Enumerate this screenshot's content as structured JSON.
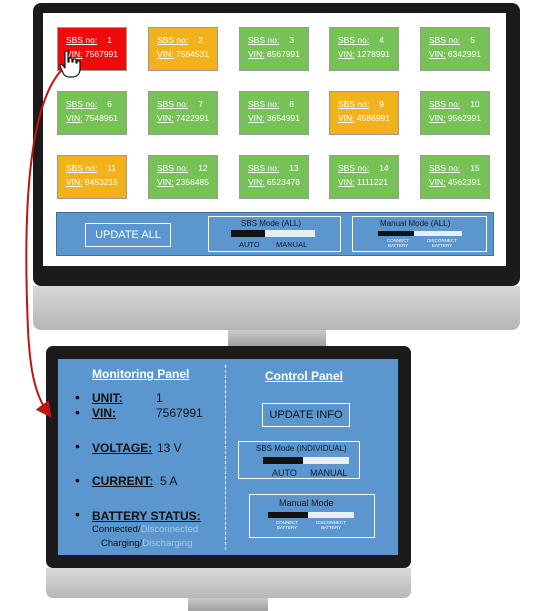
{
  "tiles": [
    {
      "sbs_label": "SBS no:",
      "sbs_no": "1",
      "vin_label": "VIN:",
      "vin": "7567991",
      "status": "red"
    },
    {
      "sbs_label": "SBS no:",
      "sbs_no": "2",
      "vin_label": "VIN:",
      "vin": "7564531",
      "status": "orange"
    },
    {
      "sbs_label": "SBS no:",
      "sbs_no": "3",
      "vin_label": "VIN:",
      "vin": "8567991",
      "status": "green"
    },
    {
      "sbs_label": "SBS no:",
      "sbs_no": "4",
      "vin_label": "VIN:",
      "vin": "1278991",
      "status": "green"
    },
    {
      "sbs_label": "SBS no:",
      "sbs_no": "5",
      "vin_label": "VIN:",
      "vin": "6342991",
      "status": "green"
    },
    {
      "sbs_label": "SBS no:",
      "sbs_no": "6",
      "vin_label": "VIN:",
      "vin": "7548961",
      "status": "green"
    },
    {
      "sbs_label": "SBS no:",
      "sbs_no": "7",
      "vin_label": "VIN:",
      "vin": "7422991",
      "status": "green"
    },
    {
      "sbs_label": "SBS no:",
      "sbs_no": "8",
      "vin_label": "VIN:",
      "vin": "3654991",
      "status": "green"
    },
    {
      "sbs_label": "SBS no:",
      "sbs_no": "9",
      "vin_label": "VIN:",
      "vin": "4586991",
      "status": "orange"
    },
    {
      "sbs_label": "SBS no:",
      "sbs_no": "10",
      "vin_label": "VIN:",
      "vin": "9562991",
      "status": "green"
    },
    {
      "sbs_label": "SBS no:",
      "sbs_no": "11",
      "vin_label": "VIN:",
      "vin": "9453215",
      "status": "orange"
    },
    {
      "sbs_label": "SBS no:",
      "sbs_no": "12",
      "vin_label": "VIN:",
      "vin": "2356485",
      "status": "green"
    },
    {
      "sbs_label": "SBS no:",
      "sbs_no": "13",
      "vin_label": "VIN:",
      "vin": "6523478",
      "status": "green"
    },
    {
      "sbs_label": "SBS no:",
      "sbs_no": "14",
      "vin_label": "VIN:",
      "vin": "1111221",
      "status": "green"
    },
    {
      "sbs_label": "SBS no:",
      "sbs_no": "15",
      "vin_label": "VIN:",
      "vin": "4562391",
      "status": "green"
    }
  ],
  "colors": {
    "green": "#77c257",
    "orange": "#f2b21c",
    "red": "#ee0b0b",
    "panel": "#5b96cf",
    "arrow": "#c0150f"
  },
  "top_controls": {
    "update_all": "UPDATE ALL",
    "sbs_mode_title": "SBS Mode (ALL)",
    "auto": "AUTO",
    "manual": "MANUAL",
    "manual_mode_title": "Manual Mode (ALL)",
    "connect_1": "CONNECT",
    "connect_2": "BATTERY",
    "disconnect_1": "DISCONNECT",
    "disconnect_2": "BATTERY"
  },
  "monitoring": {
    "title": "Monitoring Panel",
    "unit_label": "UNIT:",
    "unit": "1",
    "vin_label": "VIN:",
    "vin": "7567991",
    "voltage_label": "VOLTAGE:",
    "voltage": "13 V",
    "current_label": "CURRENT:",
    "current": "5 A",
    "battery_label": "BATTERY STATUS:",
    "connected": "Connected/",
    "disconnected": "Disconnected",
    "charging": "Charging/",
    "discharging": "Discharging"
  },
  "control": {
    "title": "Control Panel",
    "update_info": "UPDATE INFO",
    "sbs_mode_title": "SBS Mode (INDIVIDUAL)",
    "auto": "AUTO",
    "manual": "MANUAL",
    "manual_mode_title": "Manual Mode",
    "connect_1": "CONNECT",
    "connect_2": "BATTERY",
    "disconnect_1": "DISCONNECT",
    "disconnect_2": "BATTERY"
  },
  "icons": {
    "cursor": "hand-pointer-icon",
    "arrow": "curved-arrow-icon"
  }
}
